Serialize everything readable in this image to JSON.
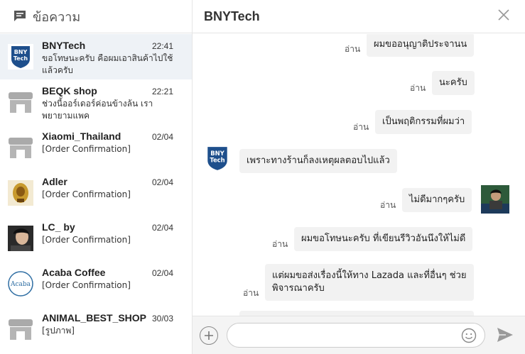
{
  "sidebar": {
    "title": "ข้อความ",
    "conversations": [
      {
        "name": "BNYTech",
        "time": "22:41",
        "preview": "ขอโทษนะครับ คือผมเอาสินค้าไปใช้แล้วครับ"
      },
      {
        "name": "BEQK shop",
        "time": "22:21",
        "preview": "ช่วงนี้ออร์เดอร์ค่อนข้างล้น เราพยายามแพค"
      },
      {
        "name": "Xiaomi_Thailand",
        "time": "02/04",
        "preview": "[Order Confirmation]"
      },
      {
        "name": "Adler",
        "time": "02/04",
        "preview": "[Order Confirmation]"
      },
      {
        "name": "LC_ by",
        "time": "02/04",
        "preview": "[Order Confirmation]"
      },
      {
        "name": "Acaba Coffee",
        "time": "02/04",
        "preview": "[Order Confirmation]"
      },
      {
        "name": "ANIMAL_BEST_SHOP",
        "time": "30/03",
        "preview": "[รูปภาพ]"
      }
    ]
  },
  "chat": {
    "title": "BNYTech",
    "read_label": "อ่าน",
    "messages": [
      {
        "side": "out",
        "text": "ผมขออนุญาติประจานน",
        "read": "อ่าน"
      },
      {
        "side": "out",
        "text": "นะครับ",
        "read": "อ่าน"
      },
      {
        "side": "out",
        "text": "เป็นพฤติกรรมที่ผมว่า",
        "read": "อ่าน"
      },
      {
        "side": "in",
        "text": "เพราะทางร้านก็ลงเหตุผลตอบไปแล้ว"
      },
      {
        "side": "out",
        "text": "ไม่ดีมากๆครับ",
        "read": "อ่าน"
      },
      {
        "side": "out",
        "text": "ผมขอโทษนะครับ ที่เขียนรีวิวอันนึงให้ไม่ดี",
        "read": "อ่าน"
      },
      {
        "side": "out",
        "text_line1": "แต่ผมขอส่งเรื่องนี้ให้ทาง Lazada และที่อื่นๆ ช่วย",
        "text_line2": "พิจารณาครับ",
        "read": "อ่าน"
      }
    ],
    "input": {
      "placeholder": "",
      "value": ""
    }
  },
  "avatar_text": {
    "bny_line1": "BNY",
    "bny_line2": "Tech",
    "acaba": "Acaba"
  }
}
